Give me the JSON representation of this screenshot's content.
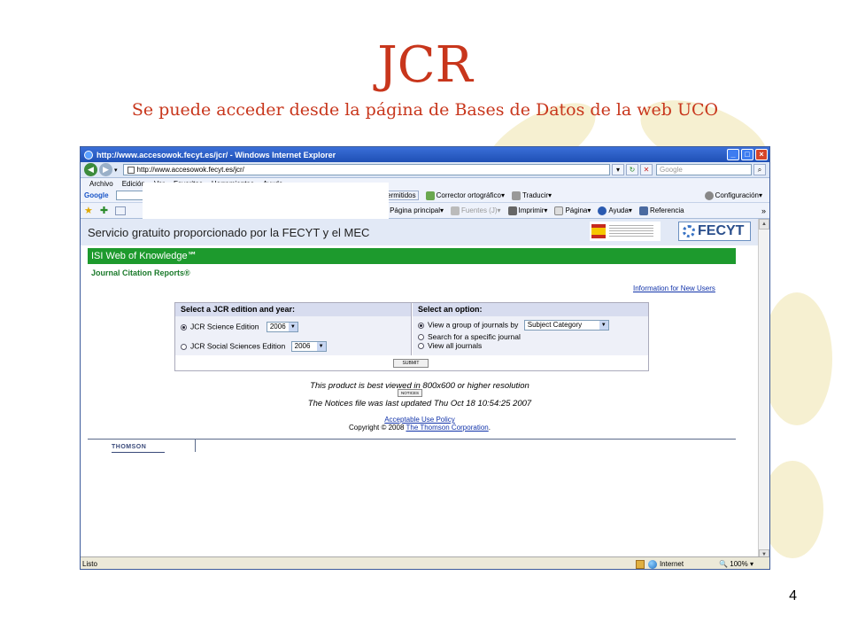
{
  "slide": {
    "title": "JCR",
    "subtitle": "Se puede acceder desde la página de Bases de Datos de la web UCO",
    "page_number": "4"
  },
  "browser": {
    "window_title": "http://www.accesowok.fecyt.es/jcr/ - Windows Internet Explorer",
    "url": "http://www.accesowok.fecyt.es/jcr/",
    "search_placeholder": "Google",
    "menu": [
      "Archivo",
      "Edición",
      "Ver",
      "Favoritos",
      "Herramientas",
      "Ayuda"
    ],
    "toolbar1": {
      "google_label": "Google",
      "popups_label": "ups permitidos",
      "spell_label": "Corrector ortográfico",
      "translate_label": "Traducir",
      "settings_label": "Configuración"
    },
    "toolbar2": {
      "home_label": "Página principal",
      "feeds_label": "Fuentes (J)",
      "print_label": "Imprimir",
      "page_label": "Página",
      "help_label": "Ayuda",
      "reference_label": "Referencia"
    },
    "status": {
      "left": "Listo",
      "zone": "Internet",
      "zoom": "100%"
    }
  },
  "page": {
    "fecyt_banner": "Servicio gratuito proporcionado por la FECYT y el MEC",
    "fecyt_logo": "FECYT",
    "isi_title": "ISI Web of Knowledge℠",
    "jcr_label": "Journal Citation Reports®",
    "info_link": "Information for New Users",
    "edition_header": "Select a JCR edition and year:",
    "option_header": "Select an option:",
    "editions": [
      {
        "label": "JCR Science Edition",
        "year": "2006"
      },
      {
        "label": "JCR Social Sciences Edition",
        "year": "2006"
      }
    ],
    "options": [
      {
        "label": "View a group of journals by"
      },
      {
        "label": "Search for a specific journal"
      },
      {
        "label": "View all journals"
      }
    ],
    "group_select": "Subject Category",
    "submit_label": "SUBMIT",
    "best_viewed": "This product is best viewed in 800x600 or higher resolution",
    "notices_label": "NOTICES",
    "notices_updated": "The Notices file was last updated Thu Oct 18 10:54:25 2007",
    "aup_link": "Acceptable Use Policy",
    "copyright_prefix": "Copyright © 2008",
    "copyright_link": "The Thomson Corporation",
    "copyright_suffix": ".",
    "thomson_logo": "THOMSON"
  },
  "colors": {
    "title_red": "#c8361c",
    "isi_green": "#1d9a2d",
    "ie_blue": "#1f4fb5"
  }
}
